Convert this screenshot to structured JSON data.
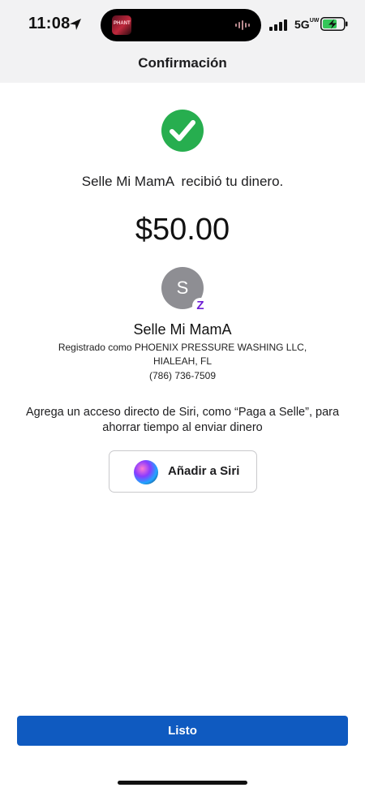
{
  "status_bar": {
    "time": "11:08",
    "network": "5G",
    "network_suffix": "UW",
    "island_thumb_text": "PHANT",
    "location_icon": "location-arrow-icon",
    "signal_icon": "cellular-signal-icon",
    "battery_icon": "battery-charging-icon"
  },
  "header": {
    "title": "Confirmación"
  },
  "confirmation": {
    "status_icon": "check-circle-icon",
    "status_color": "#27ae4f",
    "message": "Selle Mi MamA  recibió tu dinero.",
    "amount": "$50.00"
  },
  "payee": {
    "avatar_initial": "S",
    "avatar_color": "#8e8e93",
    "badge_icon": "zelle-z-icon",
    "badge_text": "Z",
    "badge_color": "#6d1ed4",
    "name": "Selle Mi MamA",
    "registered_line1": "Registrado como PHOENIX PRESSURE WASHING LLC,",
    "registered_line2": "HIALEAH, FL",
    "phone": "(786) 736-7509"
  },
  "siri": {
    "prompt_line1": "Agrega un acceso directo de Siri, como “Paga a Selle”, para",
    "prompt_line2": "ahorrar tiempo al enviar dinero",
    "button_label": "Añadir a Siri",
    "button_icon": "siri-orb-icon"
  },
  "footer": {
    "done_label": "Listo",
    "done_color": "#0f5ac0"
  }
}
